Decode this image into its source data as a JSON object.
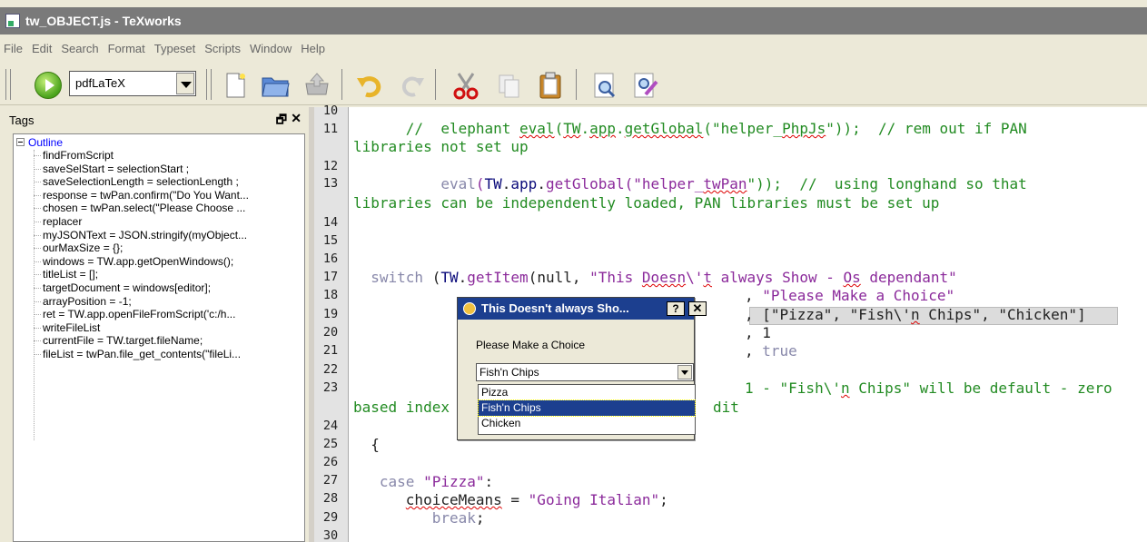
{
  "window": {
    "title": "tw_OBJECT.js - TeXworks"
  },
  "menu": [
    "File",
    "Edit",
    "Search",
    "Format",
    "Typeset",
    "Scripts",
    "Window",
    "Help"
  ],
  "toolbar": {
    "engine": "pdfLaTeX",
    "icons": [
      "new-document-icon",
      "open-folder-icon",
      "save-icon",
      "undo-icon",
      "redo-icon",
      "cut-icon",
      "copy-icon",
      "paste-icon",
      "find-icon",
      "replace-icon"
    ]
  },
  "tags": {
    "title": "Tags",
    "float_glyph": "🗗",
    "close_glyph": "✕",
    "outline": "Outline",
    "items": [
      "findFromScript",
      "saveSelStart = selectionStart ;",
      "saveSelectionLength = selectionLength ;",
      "response = twPan.confirm(\"Do You Want...",
      "chosen = twPan.select(\"Please Choose ...",
      "replacer",
      "myJSONText = JSON.stringify(myObject...",
      "ourMaxSize = {};",
      "windows = TW.app.getOpenWindows();",
      "titleList = [];",
      "targetDocument = windows[editor];",
      "arrayPosition = -1;",
      " ret = TW.app.openFileFromScript('c:/h...",
      "writeFileList",
      " currentFile = TW.target.fileName;",
      " fileList = twPan.file_get_contents(\"fileLi..."
    ]
  },
  "editor": {
    "lines": [
      {
        "n": "10"
      },
      {
        "n": "11"
      },
      {
        "n": "12"
      },
      {
        "n": "13"
      },
      {
        "n": "14"
      },
      {
        "n": "15"
      },
      {
        "n": "16"
      },
      {
        "n": "17"
      },
      {
        "n": "18"
      },
      {
        "n": "19"
      },
      {
        "n": "20"
      },
      {
        "n": "21"
      },
      {
        "n": "22"
      },
      {
        "n": "23"
      },
      {
        "n": "24"
      },
      {
        "n": "25"
      },
      {
        "n": "26"
      },
      {
        "n": "27"
      },
      {
        "n": "28"
      },
      {
        "n": "29"
      },
      {
        "n": "30"
      }
    ],
    "text": {
      "l11a": "      //  elephant ",
      "l11b": "eval",
      "l11c": "(",
      "l11d": "TW",
      "l11e": ".",
      "l11f": "app",
      "l11g": ".",
      "l11h": "getGlobal",
      "l11i": "(\"helper_",
      "l11j": "PhpJs",
      "l11k": "\"));  // rem out if PAN",
      "l11w": "libraries not set up",
      "l13a": "          eval",
      "l13b": "(",
      "l13c": "TW",
      "l13d": ".",
      "l13e": "app",
      "l13f": ".",
      "l13g": "getGlobal",
      "l13h": "(\"helper_",
      "l13i": "twPan",
      "l13j": "\"));  //  using longhand so that",
      "l13w": "libraries can be independently loaded, PAN libraries must be set up",
      "l17a": "  switch ",
      "l17b": "(",
      "l17c": "TW",
      "l17d": ".",
      "l17e": "getItem",
      "l17f": "(null, ",
      "l17g": "\"This ",
      "l17h": "Doesn",
      "l17i": "\\'",
      "l17j": "t",
      "l17k": " always Show - ",
      "l17l": "Os",
      "l17m": " dependant\"",
      "l18a": ", ",
      "l18b": "\"Please Make a Choice\"",
      "l19a": ", ",
      "l19b": "[\"Pizza\", \"Fish\\'",
      "l19c": "n",
      "l19d": " Chips\", \"Chicken\"]",
      "l20a": ", ",
      "l20b": "1",
      "l21a": ", ",
      "l21b": "true",
      "l23a": "1 - \"Fish\\'",
      "l23b": "n",
      "l23c": " Chips\" will be default - zero",
      "l23w1": "based index",
      "l23w2": "dit",
      "l25": "  {",
      "l27a": "   case ",
      "l27b": "\"Pizza\"",
      "l27c": ":",
      "l28a": "      ",
      "l28b": "choiceMeans",
      "l28c": " = ",
      "l28d": "\"Going Italian\"",
      "l28e": ";",
      "l29a": "         break",
      "l29b": ";"
    }
  },
  "dialog": {
    "title": "This Doesn't always Sho...",
    "help": "?",
    "close": "✕",
    "prompt": "Please Make a Choice",
    "selected": "Fish'n Chips",
    "options": [
      "Pizza",
      "Fish'n Chips",
      "Chicken"
    ]
  }
}
